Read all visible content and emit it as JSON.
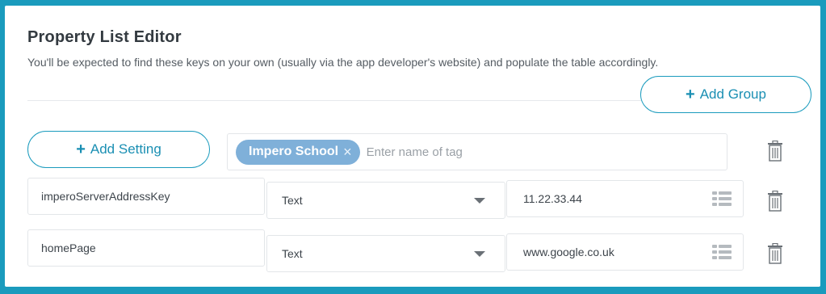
{
  "editor": {
    "title": "Property List Editor",
    "description": "You'll be expected to find these keys on your own (usually via the app developer's website) and populate the table accordingly."
  },
  "actions": {
    "add_group_label": "Add Group",
    "add_setting_label": "Add Setting",
    "plus_glyph": "+"
  },
  "tags": {
    "chips": [
      {
        "label": "Impero School",
        "remove_glyph": "×"
      }
    ],
    "placeholder": "Enter name of tag"
  },
  "settings": [
    {
      "key": "imperoServerAddressKey",
      "type": "Text",
      "value": "11.22.33.44"
    },
    {
      "key": "homePage",
      "type": "Text",
      "value": "www.google.co.uk"
    }
  ],
  "icons": {
    "trash": "trash-icon",
    "list": "list-icon",
    "dropdown": "chevron-down-icon"
  },
  "colors": {
    "accent": "#1a9bbd",
    "tag_chip": "#7fb0d9",
    "border": "#e3e6e9"
  }
}
